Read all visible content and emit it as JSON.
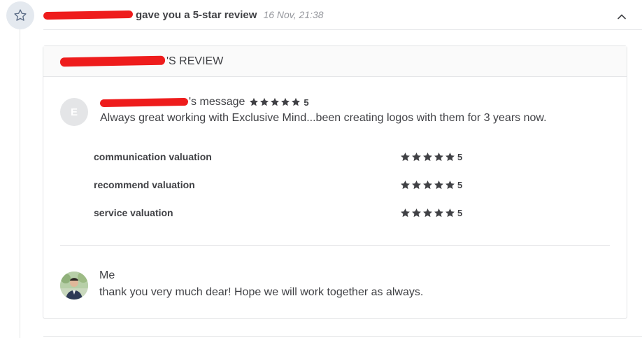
{
  "notification": {
    "text": "gave you a 5-star review",
    "time": "16 Nov, 21:38"
  },
  "review": {
    "header_suffix": "'S REVIEW",
    "avatar_letter": "E",
    "message_suffix": "'s message",
    "overall_rating": "5",
    "message": "Always great working with Exclusive Mind...been creating logos with them for 3 years now.",
    "valuations": [
      {
        "label": "communication valuation",
        "rating": "5"
      },
      {
        "label": "recommend valuation",
        "rating": "5"
      },
      {
        "label": "service valuation",
        "rating": "5"
      }
    ]
  },
  "reply": {
    "name": "Me",
    "message": "thank you very much dear! Hope we will work together as always."
  },
  "colors": {
    "text": "#404145",
    "muted": "#95979d",
    "redaction": "#ee1c1c",
    "star": "#404145"
  },
  "icons": {
    "notification": "star-outline-icon",
    "collapse": "chevron-up-icon",
    "rating": "star-filled-icon"
  }
}
